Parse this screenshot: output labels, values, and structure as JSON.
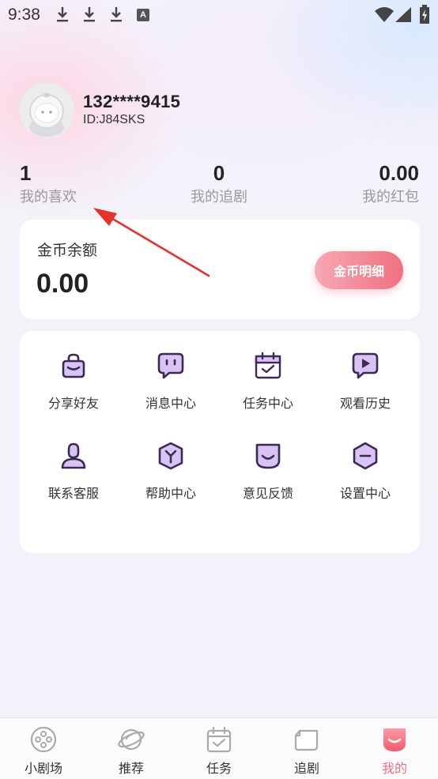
{
  "status_bar": {
    "time": "9:38",
    "icons": [
      "download-icon",
      "download-icon",
      "download-icon",
      "a-icon",
      "wifi-icon",
      "signal-icon",
      "battery-icon"
    ],
    "a_icon_text": "A"
  },
  "profile": {
    "username": "132****9415",
    "user_id": "ID:J84SKS"
  },
  "stats": [
    {
      "value": "1",
      "label": "我的喜欢"
    },
    {
      "value": "0",
      "label": "我的追剧"
    },
    {
      "value": "0.00",
      "label": "我的红包"
    }
  ],
  "coin": {
    "title": "金币余额",
    "amount": "0.00",
    "button_label": "金币明细"
  },
  "menu": [
    {
      "label": "分享好友",
      "icon": "share-bag-icon"
    },
    {
      "label": "消息中心",
      "icon": "message-icon"
    },
    {
      "label": "任务中心",
      "icon": "task-calendar-icon"
    },
    {
      "label": "观看历史",
      "icon": "history-play-icon"
    },
    {
      "label": "联系客服",
      "icon": "customer-service-icon"
    },
    {
      "label": "帮助中心",
      "icon": "help-icon"
    },
    {
      "label": "意见反馈",
      "icon": "feedback-icon"
    },
    {
      "label": "设置中心",
      "icon": "settings-icon"
    }
  ],
  "bottom_nav": [
    {
      "label": "小剧场",
      "icon": "film-reel-icon",
      "active": false
    },
    {
      "label": "推荐",
      "icon": "planet-icon",
      "active": false
    },
    {
      "label": "任务",
      "icon": "task-icon",
      "active": false
    },
    {
      "label": "追剧",
      "icon": "folder-icon",
      "active": false
    },
    {
      "label": "我的",
      "icon": "profile-icon",
      "active": true
    }
  ],
  "colors": {
    "accent": "#f0707f",
    "menu_icon_fill": "#d9c3f4",
    "menu_icon_stroke": "#3a2a55",
    "text_primary": "#222222",
    "text_secondary": "#9a9a9a"
  }
}
